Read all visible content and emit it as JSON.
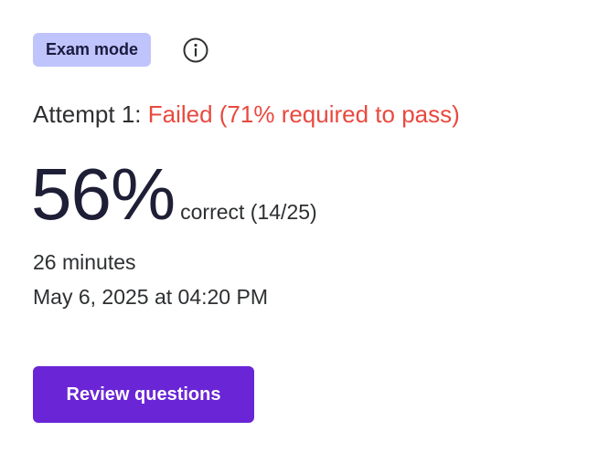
{
  "header": {
    "badge_label": "Exam mode",
    "info_icon": "info-circle-icon"
  },
  "attempt": {
    "label": "Attempt 1:",
    "status_text": "Failed (71% required to pass)",
    "status_color": "#e9493f"
  },
  "score": {
    "percent_text": "56%",
    "caption": "correct (14/25)",
    "percent_value": 56,
    "correct": 14,
    "total": 25
  },
  "details": {
    "duration": "26 minutes",
    "date": "May 6, 2025 at 04:20 PM"
  },
  "actions": {
    "review_label": "Review questions",
    "button_color": "#6a25d6"
  },
  "colors": {
    "badge_bg": "#c0c4fc",
    "text": "#2d2f31"
  }
}
